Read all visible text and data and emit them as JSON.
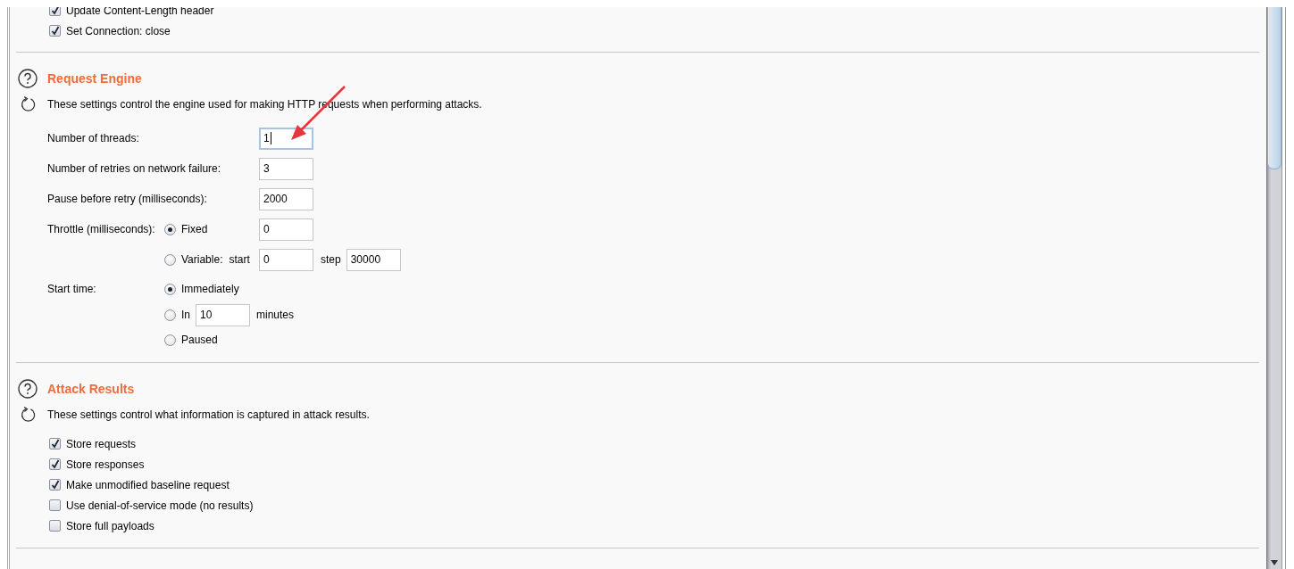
{
  "top_options": [
    {
      "label": "Update Content-Length header",
      "checked": true
    },
    {
      "label": "Set Connection: close",
      "checked": true
    }
  ],
  "request_engine": {
    "title": "Request Engine",
    "description": "These settings control the engine used for making HTTP requests when performing attacks.",
    "fields": [
      {
        "label": "Number of threads:",
        "value": "1",
        "focused": true
      },
      {
        "label": "Number of retries on network failure:",
        "value": "3",
        "focused": false
      },
      {
        "label": "Pause before retry (milliseconds):",
        "value": "2000",
        "focused": false
      }
    ],
    "throttle": {
      "label": "Throttle (milliseconds):",
      "options": [
        {
          "kind": "fixed",
          "label": "Fixed",
          "selected": true,
          "value": "0"
        },
        {
          "kind": "variable",
          "label": "Variable:",
          "selected": false,
          "start_label": "start",
          "start": "0",
          "step_label": "step",
          "step": "30000"
        }
      ]
    },
    "start_time": {
      "label": "Start time:",
      "options": [
        {
          "kind": "plain",
          "label": "Immediately",
          "selected": true
        },
        {
          "kind": "delay",
          "label": "In",
          "selected": false,
          "value": "10",
          "unit": "minutes"
        },
        {
          "kind": "plain",
          "label": "Paused",
          "selected": false
        }
      ]
    }
  },
  "attack_results": {
    "title": "Attack Results",
    "description": "These settings control what information is captured in attack results.",
    "options": [
      {
        "label": "Store requests",
        "checked": true
      },
      {
        "label": "Store responses",
        "checked": true
      },
      {
        "label": "Make unmodified baseline request",
        "checked": true
      },
      {
        "label": "Use denial-of-service mode (no results)",
        "checked": false
      },
      {
        "label": "Store full payloads",
        "checked": false
      }
    ]
  }
}
